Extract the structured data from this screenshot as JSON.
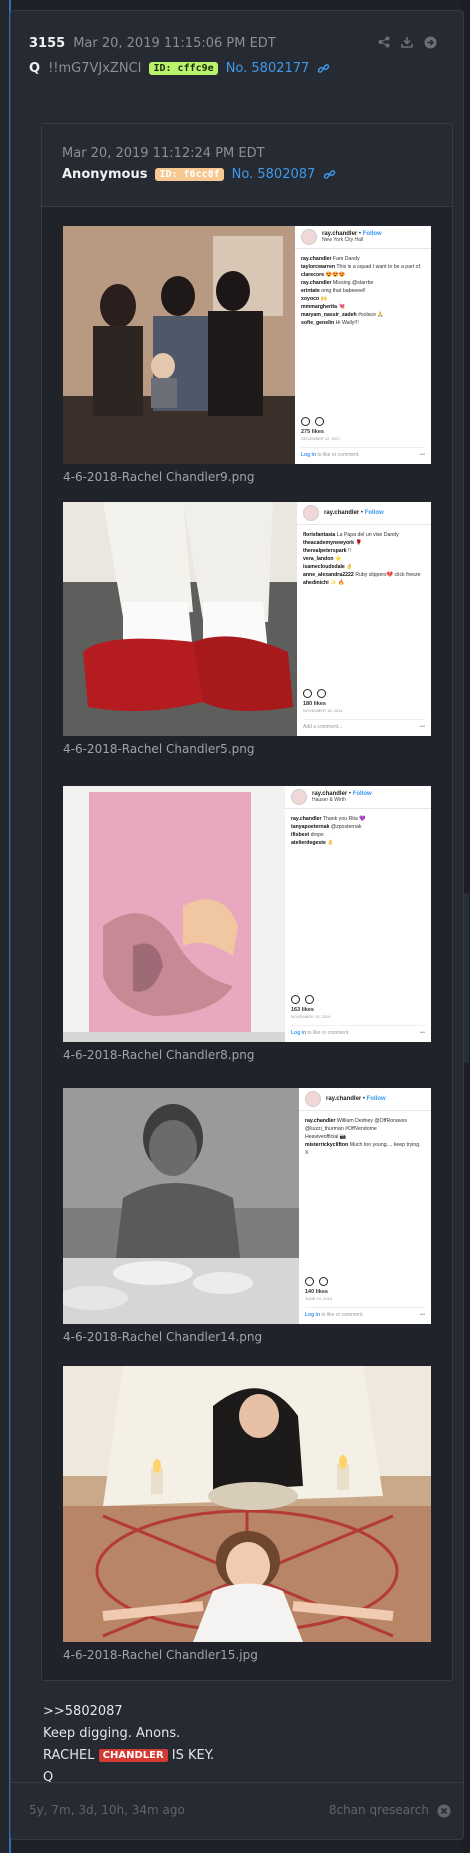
{
  "post": {
    "number": "3155",
    "date": "Mar 20, 2019 11:15:06 PM EDT",
    "author": "Q",
    "tripcode": "!!mG7VJxZNCI",
    "id_badge": "ID: cffc9e",
    "post_link": "No. 5802177",
    "icons": [
      "share-icon",
      "download-icon",
      "arrow-right-circle-icon"
    ]
  },
  "quoted": {
    "date": "Mar 20, 2019 11:12:24 PM EDT",
    "author": "Anonymous",
    "id_badge": "ID: f6cc8f",
    "post_link": "No. 5802087",
    "images": [
      {
        "caption": "4-6-2018-Rachel Chandler9.png",
        "ig": {
          "user": "ray.chandler",
          "follow": "Follow",
          "location": "New York City Hall",
          "comments": [
            [
              "ray.chandler",
              "Fam Dandy"
            ],
            [
              "taylorcwarren",
              "This is a squad I want to be a part of."
            ],
            [
              "clarecore",
              "😍😍😍"
            ],
            [
              "ray.chandler",
              "Missing @starrbe"
            ],
            [
              "erintate",
              "omg that babeeeel!"
            ],
            [
              "xoyoco",
              "🙌"
            ],
            [
              "mmmargherita",
              "💘"
            ],
            [
              "maryam_nassir_zadeh",
              "#solace 🙏"
            ],
            [
              "sofie_genelin",
              "Hi Wally!!!"
            ]
          ],
          "likes": "275 likes",
          "date": "DECEMBER 12, 2017",
          "login": "Log in",
          "login_rest": "to like or comment."
        }
      },
      {
        "caption": "4-6-2018-Rachel Chandler5.png",
        "ig": {
          "user": "ray.chandler",
          "follow": "Follow",
          "location": "",
          "comments": [
            [
              "florisfantasia",
              "La Papa del un vise Dandy"
            ],
            [
              "theacademynewyork",
              "🌹"
            ],
            [
              "therealpeterspark",
              "!!"
            ],
            [
              "vera_landon",
              "⭐"
            ],
            [
              "isamecloudsdale",
              "👌"
            ],
            [
              "anne_alexandra2222",
              "Ruby slippers💔 click freeze"
            ],
            [
              "ahedinichi",
              "✨ 🔥"
            ]
          ],
          "likes": "180 likes",
          "date": "NOVEMBER 18, 2014",
          "login": "Add a comment...",
          "login_rest": ""
        }
      },
      {
        "caption": "4-6-2018-Rachel Chandler8.png",
        "ig": {
          "user": "ray.chandler",
          "follow": "Follow",
          "location": "Hauser & Wirth",
          "comments": [
            [
              "ray.chandler",
              "Thank you Rita 💜"
            ],
            [
              "tanyapoeternak",
              "@zposternak"
            ],
            [
              "ifisbest",
              "drops"
            ],
            [
              "atelierdegeste",
              "👌"
            ]
          ],
          "likes": "163 likes",
          "date": "NOVEMBER 13, 2016",
          "login": "Log in",
          "login_rest": "to like or comment."
        }
      },
      {
        "caption": "4-6-2018-Rachel Chandler14.png",
        "ig": {
          "user": "ray.chandler",
          "follow": "Follow",
          "location": "",
          "comments": [
            [
              "ray.chandler",
              "William Dedney @OffRonaves @liuzzi_thurman #OffVendome"
            ],
            [
              "",
              "Heaviveofficial 📷"
            ],
            [
              "misterrickyclifton",
              "Much too young.... keep trying. X"
            ]
          ],
          "likes": "140 likes",
          "date": "JUNE 19, 2016",
          "login": "Log in",
          "login_rest": "to like or comment."
        }
      },
      {
        "caption": "4-6-2018-Rachel Chandler15.jpg"
      }
    ]
  },
  "body": {
    "line1": ">>5802087",
    "line2": "Keep digging. Anons.",
    "line3_pre": "RACHEL",
    "line3_mark": "CHANDLER",
    "line3_post": "IS KEY.",
    "line4": "Q"
  },
  "footer": {
    "time": "5y, 7m, 3d, 10h, 34m ago",
    "board": "8chan qresearch"
  }
}
